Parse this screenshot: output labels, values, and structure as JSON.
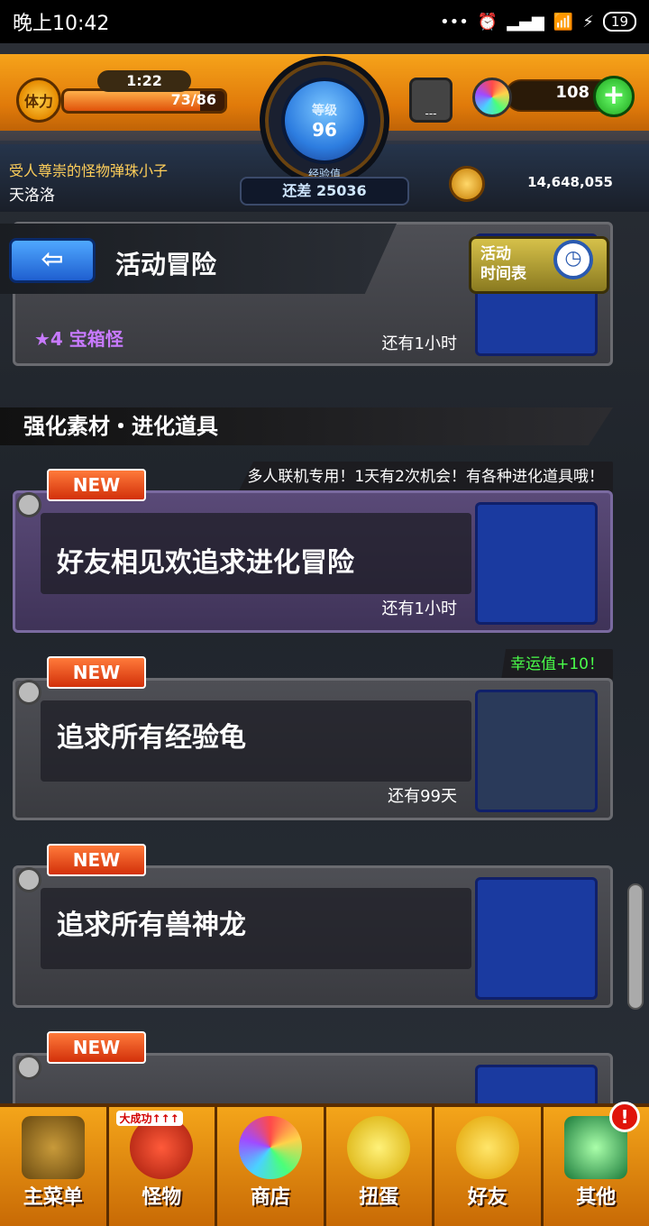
{
  "status_bar": {
    "time": "晚上10:42",
    "battery": "19"
  },
  "hud": {
    "stamina_label": "体力",
    "stamina_timer": "1:22",
    "stamina_value": "73/86",
    "stamina_fraction": 0.849,
    "level_label": "等级",
    "level": "96",
    "exp_label": "经验值",
    "exp_remaining": "还差 25036",
    "egg_label": "---",
    "gems": "108",
    "plus": "+",
    "player_title": "受人尊崇的怪物弹珠小子",
    "player_name": "天洛洛",
    "coins": "14,648,055"
  },
  "header": {
    "back_icon": "⇦",
    "title": "活动冒险",
    "schedule_line1": "活动",
    "schedule_line2": "时间表"
  },
  "cards": [
    {
      "rarity": "★4 宝箱怪",
      "time": "还有1小时"
    }
  ],
  "section": {
    "title": "强化素材・进化道具"
  },
  "quests": [
    {
      "badge": "NEW",
      "tagline": "多人联机专用！1天有2次机会！有各种进化道具哦！",
      "title": "好友相见欢追求进化冒险",
      "time": "还有1小时"
    },
    {
      "badge": "NEW",
      "tagline": "幸运值+10！",
      "title": "追求所有经验龟",
      "time": "还有99天"
    },
    {
      "badge": "NEW",
      "title": "追求所有兽神龙"
    },
    {
      "badge": "NEW"
    }
  ],
  "bottom_nav": [
    {
      "label": "主菜单"
    },
    {
      "label": "怪物",
      "badge": "大成功↑↑↑"
    },
    {
      "label": "商店"
    },
    {
      "label": "扭蛋"
    },
    {
      "label": "好友"
    },
    {
      "label": "其他",
      "alert": "!"
    }
  ]
}
